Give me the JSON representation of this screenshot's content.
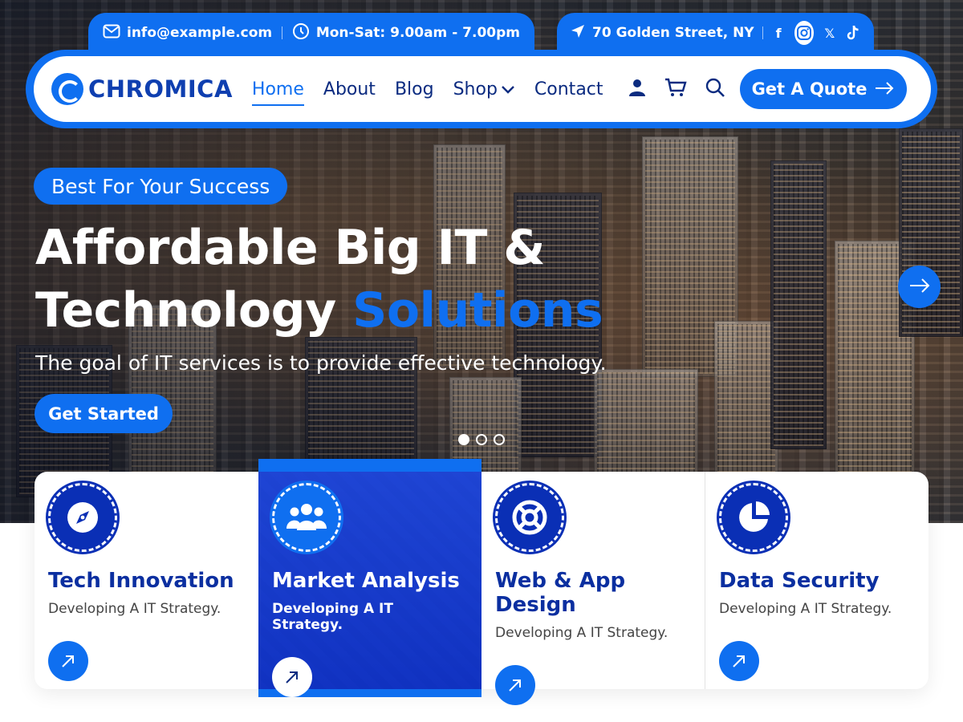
{
  "topbar": {
    "email": "info@example.com",
    "hours": "Mon-Sat: 9.00am - 7.00pm",
    "address": "70 Golden Street, NY",
    "social": [
      "facebook-icon",
      "instagram-icon",
      "x-icon",
      "tiktok-icon"
    ]
  },
  "nav": {
    "logo": "CHROMICA",
    "items": [
      {
        "label": "Home",
        "active": true
      },
      {
        "label": "About"
      },
      {
        "label": "Blog"
      },
      {
        "label": "Shop",
        "dropdown": true
      },
      {
        "label": "Contact"
      }
    ],
    "quote_label": "Get A Quote"
  },
  "hero": {
    "badge": "Best For Your Success",
    "headline_line1": "Affordable Big IT &",
    "headline_line2_plain": "Technology",
    "headline_line2_accent": "Solutions",
    "subtext": "The goal of IT services is to provide effective technology.",
    "cta": "Get Started",
    "slides": 3,
    "active_slide": 1
  },
  "features": [
    {
      "title": "Tech Innovation",
      "desc": "Developing A IT Strategy.",
      "icon": "compass-icon"
    },
    {
      "title": "Market Analysis",
      "desc": "Developing A IT Strategy.",
      "icon": "users-icon",
      "highlight": true
    },
    {
      "title": "Web & App Design",
      "desc": "Developing A IT Strategy.",
      "icon": "lifebuoy-icon"
    },
    {
      "title": "Data Security",
      "desc": "Developing A IT Strategy.",
      "icon": "pie-chart-icon"
    }
  ],
  "colors": {
    "primary": "#0f6ff0",
    "navy": "#0b2b80",
    "icon_bg": "#0a2fb5"
  }
}
